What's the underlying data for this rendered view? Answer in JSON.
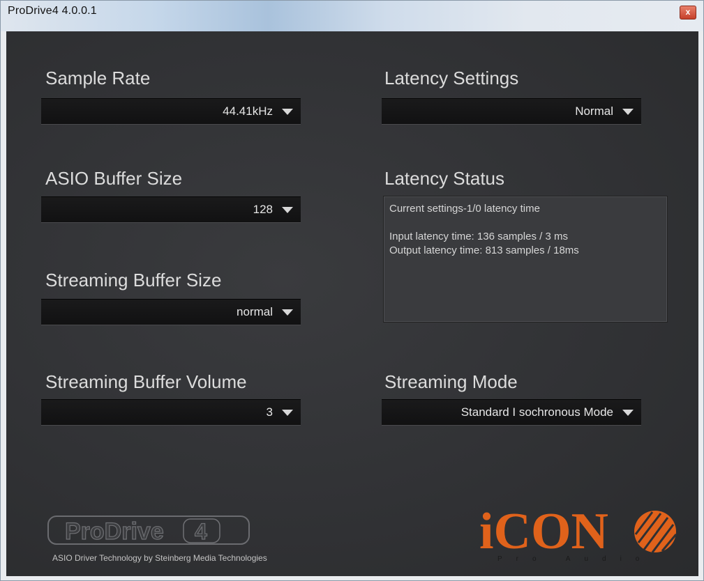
{
  "window": {
    "title": "ProDrive4 4.0.0.1",
    "close_label": "x"
  },
  "colors": {
    "panel_background": "#333437",
    "dropdown_background": "#141415",
    "label_text": "#dcdcdc",
    "icon_brand_orange": "#e0621b"
  },
  "settings": {
    "sample_rate": {
      "label": "Sample Rate",
      "value": "44.41kHz"
    },
    "latency_settings": {
      "label": "Latency Settings",
      "value": "Normal"
    },
    "asio_buffer_size": {
      "label": "ASIO Buffer Size",
      "value": "128"
    },
    "latency_status": {
      "label": "Latency Status",
      "line1": "Current settings-1/0 latency time",
      "line2": "Input latency time: 136 samples / 3 ms",
      "line3": "Output latency time: 813 samples / 18ms"
    },
    "streaming_buffer_size": {
      "label": "Streaming Buffer Size",
      "value": "normal"
    },
    "streaming_buffer_volume": {
      "label": "Streaming Buffer Volume",
      "value": "3"
    },
    "streaming_mode": {
      "label": "Streaming Mode",
      "value": "Standard I sochronous Mode"
    }
  },
  "footer": {
    "prodrive_logo_text": "ProDrive",
    "prodrive_logo_number": "4",
    "asio_credit": "ASIO Driver Technology by Steinberg Media Technologies",
    "icon_logo_text": "iCON",
    "icon_logo_subtext": "Pro Audio"
  },
  "icons": {
    "close": "close-icon",
    "dropdown": "chevron-down-icon"
  }
}
